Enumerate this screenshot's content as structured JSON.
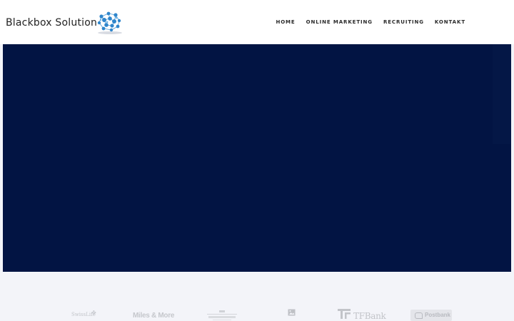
{
  "header": {
    "brand_name": "Blackbox Solution",
    "logo_icon": "network-globe-icon"
  },
  "nav": {
    "items": [
      {
        "label": "HOME"
      },
      {
        "label": "ONLINE MARKETING"
      },
      {
        "label": "RECRUITING"
      },
      {
        "label": "KONTAKT"
      }
    ]
  },
  "hero": {
    "background_color": "#021443"
  },
  "partners": {
    "swisslife": "SwissLife",
    "miles": "Miles & More",
    "tfbank": "TFBank",
    "postbank": "Postbank"
  },
  "colors": {
    "accent_blue": "#3a8fd0",
    "hero_navy": "#021443",
    "page_bg": "#f3f4f9"
  }
}
